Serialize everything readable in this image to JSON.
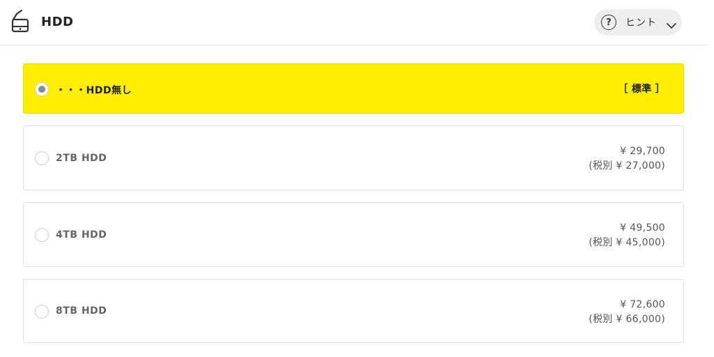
{
  "header": {
    "title": "HDD",
    "icon": "hdd-icon",
    "hint_label": "ヒント",
    "hint_icon": "question-circle-icon",
    "hint_chevron_icon": "chevron-down-icon"
  },
  "options": [
    {
      "label": "・・・HDD無し",
      "badge": "［ 標準 ］",
      "selected": true
    },
    {
      "label": "2TB HDD",
      "price": "¥ 29,700",
      "price_ex_tax": "(税別 ¥ 27,000)",
      "selected": false
    },
    {
      "label": "4TB HDD",
      "price": "¥ 49,500",
      "price_ex_tax": "(税別 ¥ 45,000)",
      "selected": false
    },
    {
      "label": "8TB HDD",
      "price": "¥ 72,600",
      "price_ex_tax": "(税別 ¥ 66,000)",
      "selected": false
    }
  ],
  "colors": {
    "selected_background": "#ffee00",
    "hint_background": "#eeeeee",
    "border": "#dedede"
  }
}
